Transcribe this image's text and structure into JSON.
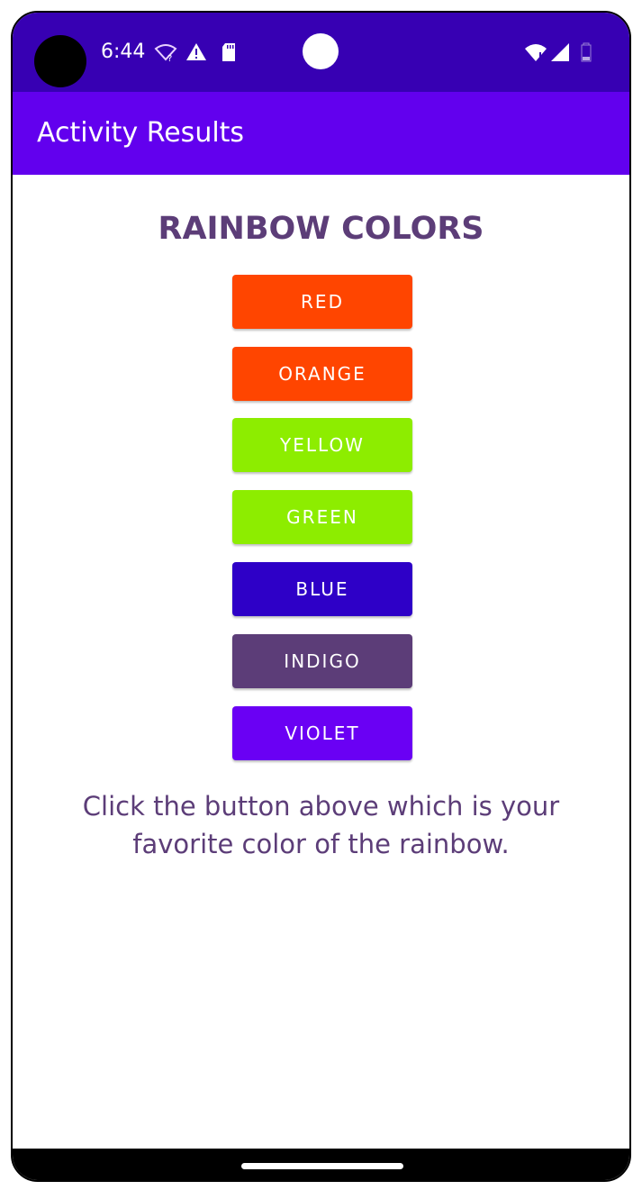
{
  "status_bar": {
    "time": "6:44",
    "background_color": "#3700b3"
  },
  "app_bar": {
    "title": "Activity Results",
    "background_color": "#6200ee"
  },
  "main": {
    "heading": "RAINBOW COLORS",
    "buttons": [
      {
        "label": "RED",
        "color": "#ff4500"
      },
      {
        "label": "ORANGE",
        "color": "#ff4500"
      },
      {
        "label": "YELLOW",
        "color": "#8ded00"
      },
      {
        "label": "GREEN",
        "color": "#8ded00"
      },
      {
        "label": "BLUE",
        "color": "#2e00c7"
      },
      {
        "label": "INDIGO",
        "color": "#5c3d78"
      },
      {
        "label": "VIOLET",
        "color": "#6a00f4"
      }
    ],
    "instruction": "Click the button above which is your favorite color of the rainbow."
  },
  "icons": {
    "status_left": [
      "wifi-unknown-icon",
      "warning-icon",
      "sd-card-icon"
    ],
    "status_right": [
      "wifi-icon",
      "cellular-signal-icon",
      "battery-icon"
    ]
  }
}
